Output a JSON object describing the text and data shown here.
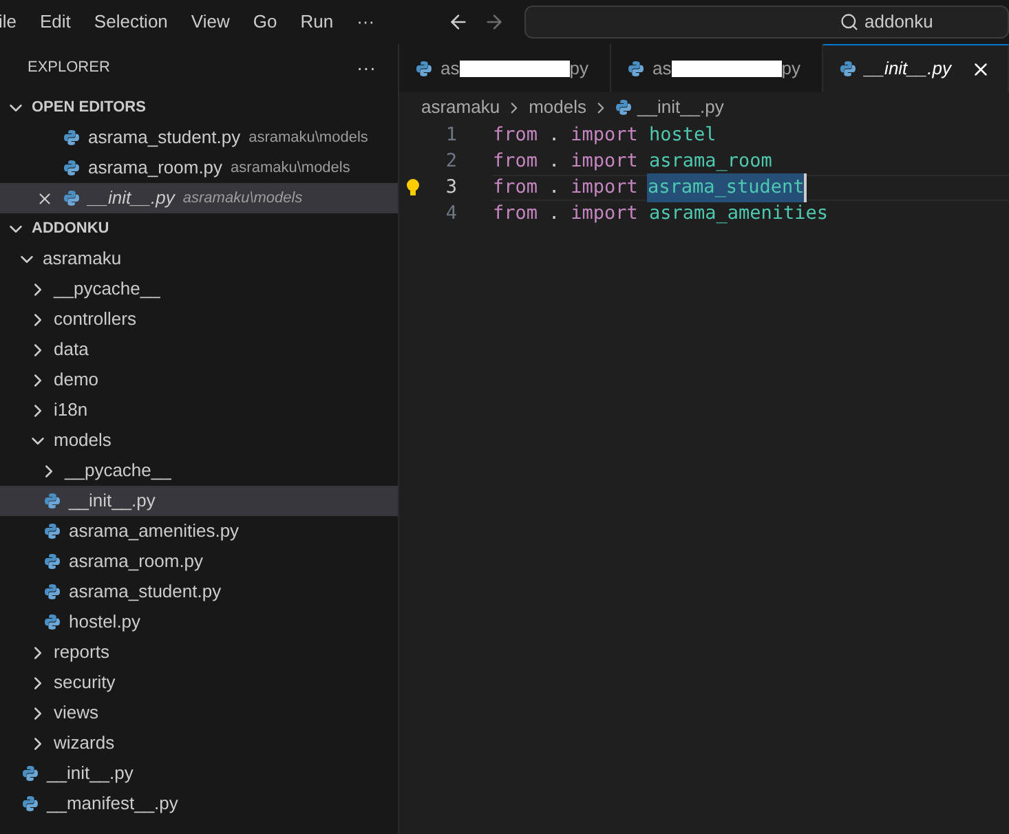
{
  "menu": [
    "ile",
    "Edit",
    "Selection",
    "View",
    "Go",
    "Run",
    "···"
  ],
  "search": {
    "value": "addonku"
  },
  "explorer": {
    "title": "EXPLORER",
    "more": "···"
  },
  "tabs": [
    {
      "label_start": "as",
      "label_end": "py",
      "redacted": true,
      "selected": false
    },
    {
      "label_start": "as",
      "label_end": "py",
      "redacted": true,
      "selected": false
    },
    {
      "label_start": "__init__.py",
      "redacted": false,
      "selected": true
    }
  ],
  "open_editors": {
    "title": "OPEN EDITORS",
    "items": [
      {
        "name": "asrama_student.py",
        "path": "asramaku\\models",
        "selected": false
      },
      {
        "name": "asrama_room.py",
        "path": "asramaku\\models",
        "selected": false
      },
      {
        "name": "__init__.py",
        "path": "asramaku\\models",
        "selected": true
      }
    ]
  },
  "workspace": {
    "title": "ADDONKU",
    "tree": [
      {
        "kind": "folder",
        "name": "asramaku",
        "expanded": true,
        "children": [
          {
            "kind": "folder",
            "name": "__pycache__",
            "expanded": false
          },
          {
            "kind": "folder",
            "name": "controllers",
            "expanded": false
          },
          {
            "kind": "folder",
            "name": "data",
            "expanded": false
          },
          {
            "kind": "folder",
            "name": "demo",
            "expanded": false
          },
          {
            "kind": "folder",
            "name": "i18n",
            "expanded": false
          },
          {
            "kind": "folder",
            "name": "models",
            "expanded": true,
            "children": [
              {
                "kind": "folder",
                "name": "__pycache__",
                "expanded": false
              },
              {
                "kind": "file",
                "name": "__init__.py",
                "selected": true
              },
              {
                "kind": "file",
                "name": "asrama_amenities.py",
                "selected": false
              },
              {
                "kind": "file",
                "name": "asrama_room.py",
                "selected": false
              },
              {
                "kind": "file",
                "name": "asrama_student.py",
                "selected": false
              },
              {
                "kind": "file",
                "name": "hostel.py",
                "selected": false
              }
            ]
          },
          {
            "kind": "folder",
            "name": "reports",
            "expanded": false
          },
          {
            "kind": "folder",
            "name": "security",
            "expanded": false
          },
          {
            "kind": "folder",
            "name": "views",
            "expanded": false
          },
          {
            "kind": "folder",
            "name": "wizards",
            "expanded": false
          }
        ]
      },
      {
        "kind": "file",
        "name": "__init__.py",
        "selected": false
      },
      {
        "kind": "file",
        "name": "__manifest__.py",
        "selected": false
      }
    ]
  },
  "breadcrumb": [
    "asramaku",
    "models",
    "__init__.py"
  ],
  "code": [
    {
      "number": "1",
      "tokens": [
        "from",
        ".",
        "import",
        "hostel"
      ],
      "current": false,
      "selected_module": false
    },
    {
      "number": "2",
      "tokens": [
        "from",
        ".",
        "import",
        "asrama_room"
      ],
      "current": false,
      "selected_module": false
    },
    {
      "number": "3",
      "tokens": [
        "from",
        ".",
        "import",
        "asrama_student"
      ],
      "current": true,
      "selected_module": true
    },
    {
      "number": "4",
      "tokens": [
        "from",
        ".",
        "import",
        "asrama_amenities"
      ],
      "current": false,
      "selected_module": false
    }
  ]
}
